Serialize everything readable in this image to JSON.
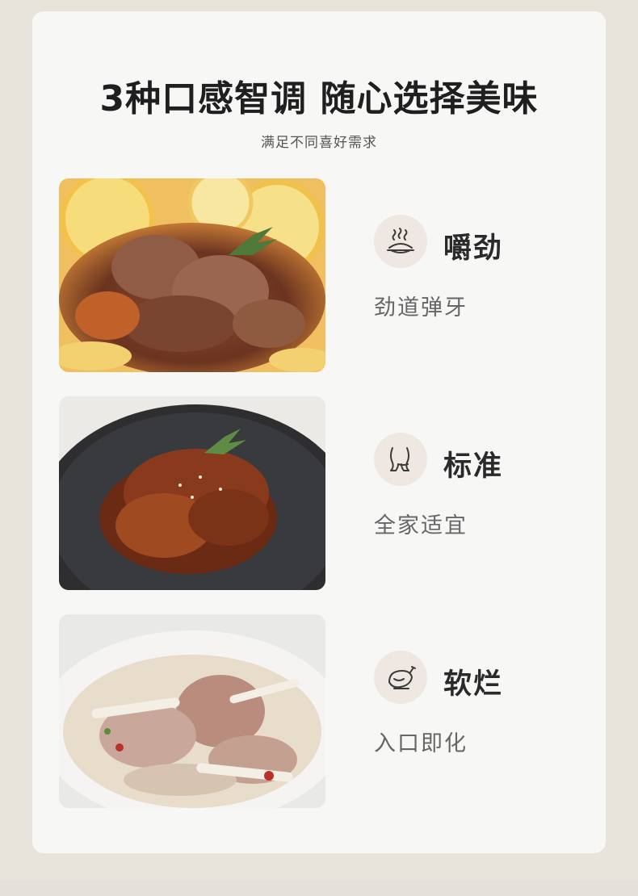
{
  "header": {
    "title": "3种口感智调 随心选择美味",
    "subtitle": "满足不同喜好需求"
  },
  "features": [
    {
      "icon": "steaming-dish-icon",
      "title": "嚼劲",
      "desc": "劲道弹牙",
      "photo": "braised-duck-with-lemon-photo"
    },
    {
      "icon": "drumstick-icon",
      "title": "标准",
      "desc": "全家适宜",
      "photo": "sauced-duck-with-sesame-photo"
    },
    {
      "icon": "roast-bird-icon",
      "title": "软烂",
      "desc": "入口即化",
      "photo": "duck-soup-with-bamboo-shoots-photo"
    }
  ],
  "colors": {
    "background": "#e8e4dc",
    "card": "#f7f7f6",
    "icon_circle": "#efe8e2",
    "title_text": "#1f1f1f"
  }
}
